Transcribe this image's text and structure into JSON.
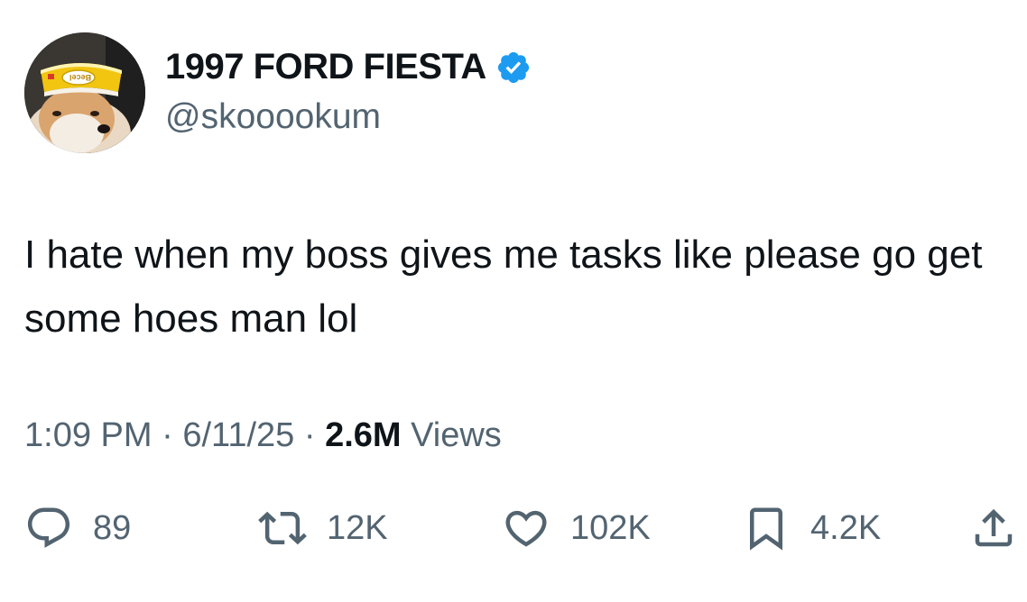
{
  "author": {
    "display_name": "1997 FORD FIESTA",
    "handle": "@skooookum",
    "verified": true,
    "avatar_cap_text": "Becel"
  },
  "tweet": {
    "text": "I hate when my boss gives me tasks like please go get some hoes man lol"
  },
  "meta": {
    "time": "1:09 PM",
    "separator": "·",
    "date": "6/11/25",
    "views_count": "2.6M",
    "views_label": "Views"
  },
  "actions": {
    "replies": "89",
    "reposts": "12K",
    "likes": "102K",
    "bookmarks": "4.2K"
  },
  "colors": {
    "text_primary": "#0f1419",
    "text_secondary": "#536471",
    "verified_blue": "#1d9bf0"
  },
  "icons": {
    "reply": "reply-icon",
    "repost": "repost-icon",
    "like": "heart-icon",
    "bookmark": "bookmark-icon",
    "share": "share-icon",
    "verified": "verified-badge-icon"
  }
}
